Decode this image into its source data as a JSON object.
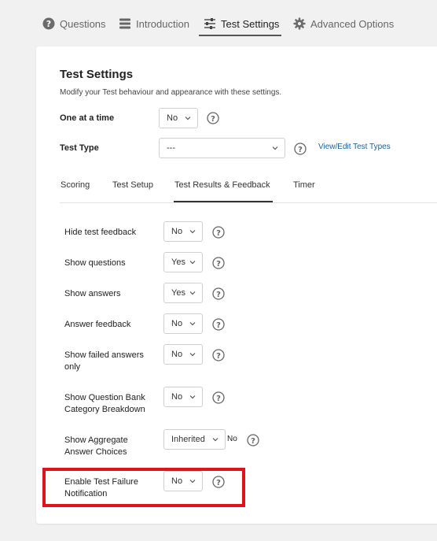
{
  "top_tabs": [
    {
      "label": "Questions",
      "icon": "question-circle-icon"
    },
    {
      "label": "Introduction",
      "icon": "list-icon"
    },
    {
      "label": "Test Settings",
      "icon": "sliders-icon"
    },
    {
      "label": "Advanced Options",
      "icon": "gear-icon"
    }
  ],
  "page": {
    "title": "Test Settings",
    "subtitle": "Modify your Test behaviour and appearance with these settings."
  },
  "general": {
    "one_at_a_time_label": "One at a time",
    "one_at_a_time_value": "No",
    "test_type_label": "Test Type",
    "test_type_value": "---",
    "view_edit_link": "View/Edit Test Types"
  },
  "sub_tabs": [
    "Scoring",
    "Test Setup",
    "Test Results & Feedback",
    "Timer"
  ],
  "settings": [
    {
      "label": "Hide test feedback",
      "value": "No"
    },
    {
      "label": "Show questions",
      "value": "Yes"
    },
    {
      "label": "Show answers",
      "value": "Yes"
    },
    {
      "label": "Answer feedback",
      "value": "No"
    },
    {
      "label": "Show failed answers only",
      "value": "No"
    },
    {
      "label": "Show Question Bank Category Breakdown",
      "value": "No"
    },
    {
      "label": "Show Aggregate Answer Choices",
      "value": "Inherited",
      "inherited_value": "No"
    },
    {
      "label": "Enable Test Failure Notification",
      "value": "No"
    }
  ],
  "colors": {
    "highlight": "#e0121b",
    "link": "#1a5f9c"
  }
}
